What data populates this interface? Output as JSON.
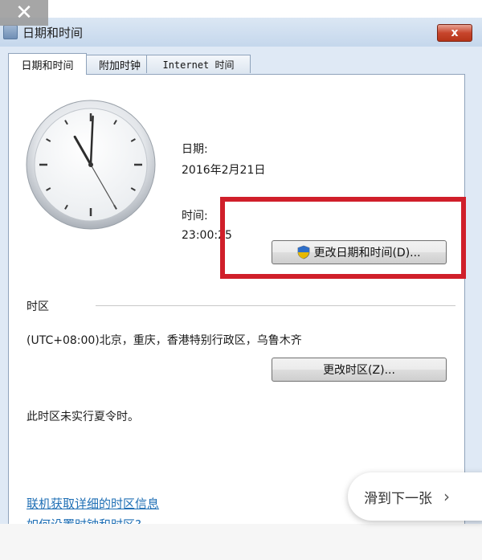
{
  "overlay": {
    "close_glyph": "✕"
  },
  "window": {
    "title": "日期和时间",
    "close_glyph": "x",
    "tabs": [
      {
        "label": "日期和时间"
      },
      {
        "label": "附加时钟"
      },
      {
        "label": "Internet 时间"
      }
    ]
  },
  "datetime": {
    "date_label": "日期:",
    "date_value": "2016年2月21日",
    "time_label": "时间:",
    "time_value": "23:00:25",
    "change_button": "更改日期和时间(D)...",
    "clock": {
      "hours": 23,
      "minutes": 0,
      "seconds": 25
    }
  },
  "timezone": {
    "section_label": "时区",
    "value": "(UTC+08:00)北京，重庆，香港特别行政区，乌鲁木齐",
    "change_button": "更改时区(Z)...",
    "dst_note": "此时区未实行夏令时。"
  },
  "links": {
    "online_info": "联机获取详细的时区信息",
    "how_to_set": "如何设置时钟和时区?"
  },
  "overlay_next": {
    "label": "滑到下一张",
    "chevron": "›"
  },
  "colors": {
    "highlight_box": "#d01f2a",
    "link": "#1f6fb5"
  },
  "icons": {
    "window": "datetime-window-icon",
    "uac": "uac-shield-icon"
  }
}
